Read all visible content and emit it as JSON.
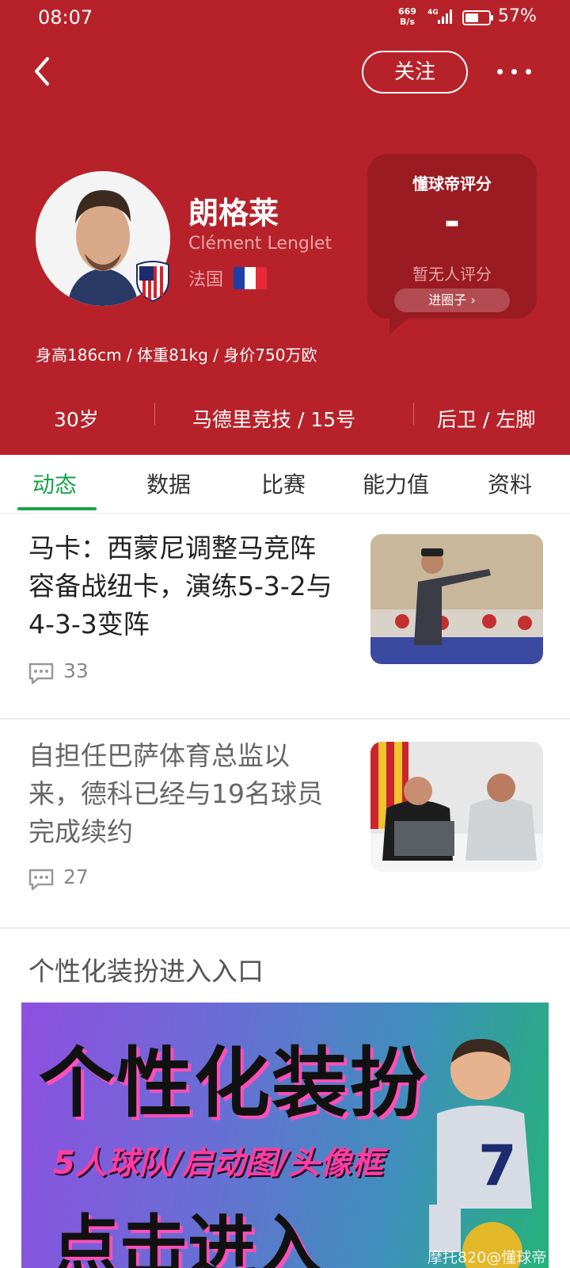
{
  "status_bar": {
    "time": "08:07",
    "net_speed_top": "669",
    "net_speed_bottom": "B/s",
    "network": "4G",
    "battery_percent": "57%",
    "battery_level": 0.57
  },
  "header": {
    "follow_label": "关注",
    "colors": {
      "background": "#b7222a",
      "card": "#9b1b22",
      "accent_green": "#1aa34a"
    }
  },
  "player": {
    "name_cn": "朗格莱",
    "name_en": "Clément Lenglet",
    "nation": "法国",
    "stats_line": "身高186cm / 体重81kg / 身价750万欧",
    "age": "30岁",
    "club_number": "马德里竞技 / 15号",
    "position_foot": "后卫 / 左脚"
  },
  "rating": {
    "title": "懂球帝评分",
    "score": "-",
    "none_text": "暂无人评分",
    "circle_btn": "进圈子"
  },
  "tabs": [
    {
      "label": "动态",
      "active": true
    },
    {
      "label": "数据",
      "active": false
    },
    {
      "label": "比赛",
      "active": false
    },
    {
      "label": "能力值",
      "active": false
    },
    {
      "label": "资料",
      "active": false
    }
  ],
  "news": [
    {
      "title": "马卡：西蒙尼调整马竞阵容备战纽卡，演练5-3-2与4-3-3变阵",
      "comments": "33"
    },
    {
      "title": "自担任巴萨体育总监以来，德科已经与19名球员完成续约",
      "comments": "27"
    }
  ],
  "section": {
    "title": "个性化装扮进入入口",
    "banner_main": "个性化装扮",
    "banner_sub": "5人球队/启动图/头像框",
    "banner_cta": "点击进入"
  },
  "watermark": "摩托820@懂球帝"
}
